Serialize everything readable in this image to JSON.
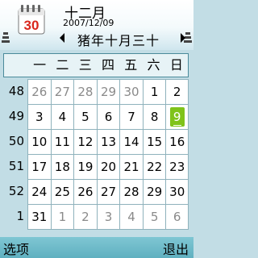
{
  "header": {
    "month_title": "十二月",
    "date": "2007/12/09",
    "icon_day": "30",
    "lunar_date": "猪年十月三十"
  },
  "weekdays": [
    "一",
    "二",
    "三",
    "四",
    "五",
    "六",
    "日"
  ],
  "weeks": [
    {
      "week": "48",
      "days": [
        "26",
        "27",
        "28",
        "29",
        "30",
        "1",
        "2"
      ]
    },
    {
      "week": "49",
      "days": [
        "3",
        "4",
        "5",
        "6",
        "7",
        "8",
        "9"
      ]
    },
    {
      "week": "50",
      "days": [
        "10",
        "11",
        "12",
        "13",
        "14",
        "15",
        "16"
      ]
    },
    {
      "week": "51",
      "days": [
        "17",
        "18",
        "19",
        "20",
        "21",
        "22",
        "23"
      ]
    },
    {
      "week": "52",
      "days": [
        "24",
        "25",
        "26",
        "27",
        "28",
        "29",
        "30"
      ]
    },
    {
      "week": "1",
      "days": [
        "31",
        "1",
        "2",
        "3",
        "4",
        "5",
        "6"
      ]
    }
  ],
  "softkeys": {
    "left": "选项",
    "right": "退出"
  },
  "colors": {
    "selected": "#7fc31a",
    "background": "#c2dde5",
    "other_month": "#8a8a8a"
  }
}
